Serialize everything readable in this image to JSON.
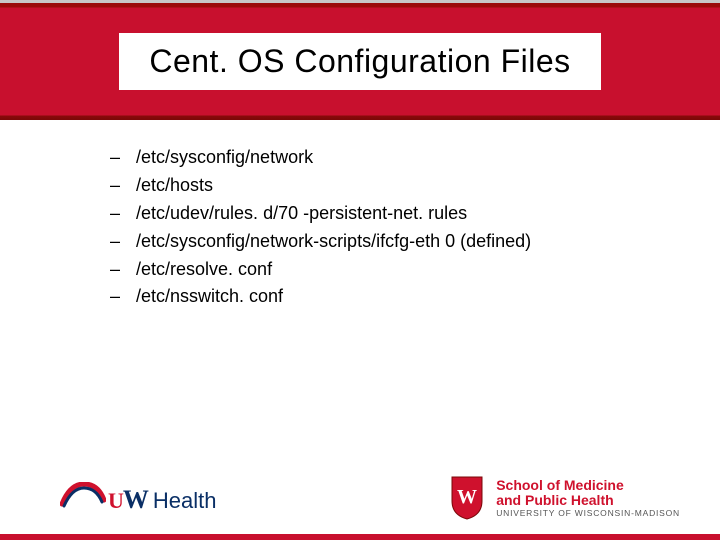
{
  "title": "Cent. OS Configuration Files",
  "items": [
    "/etc/sysconfig/network",
    "/etc/hosts",
    "/etc/udev/rules. d/70 -persistent-net. rules",
    "/etc/sysconfig/network-scripts/ifcfg-eth 0 (defined)",
    "/etc/resolve. conf",
    "/etc/nsswitch. conf"
  ],
  "footer": {
    "left": {
      "u": "U",
      "w": "W",
      "health": "Health"
    },
    "right": {
      "line1": "School of Medicine",
      "line2": "and Public Health",
      "sub": "UNIVERSITY OF WISCONSIN-MADISON"
    }
  },
  "bullet": "–"
}
